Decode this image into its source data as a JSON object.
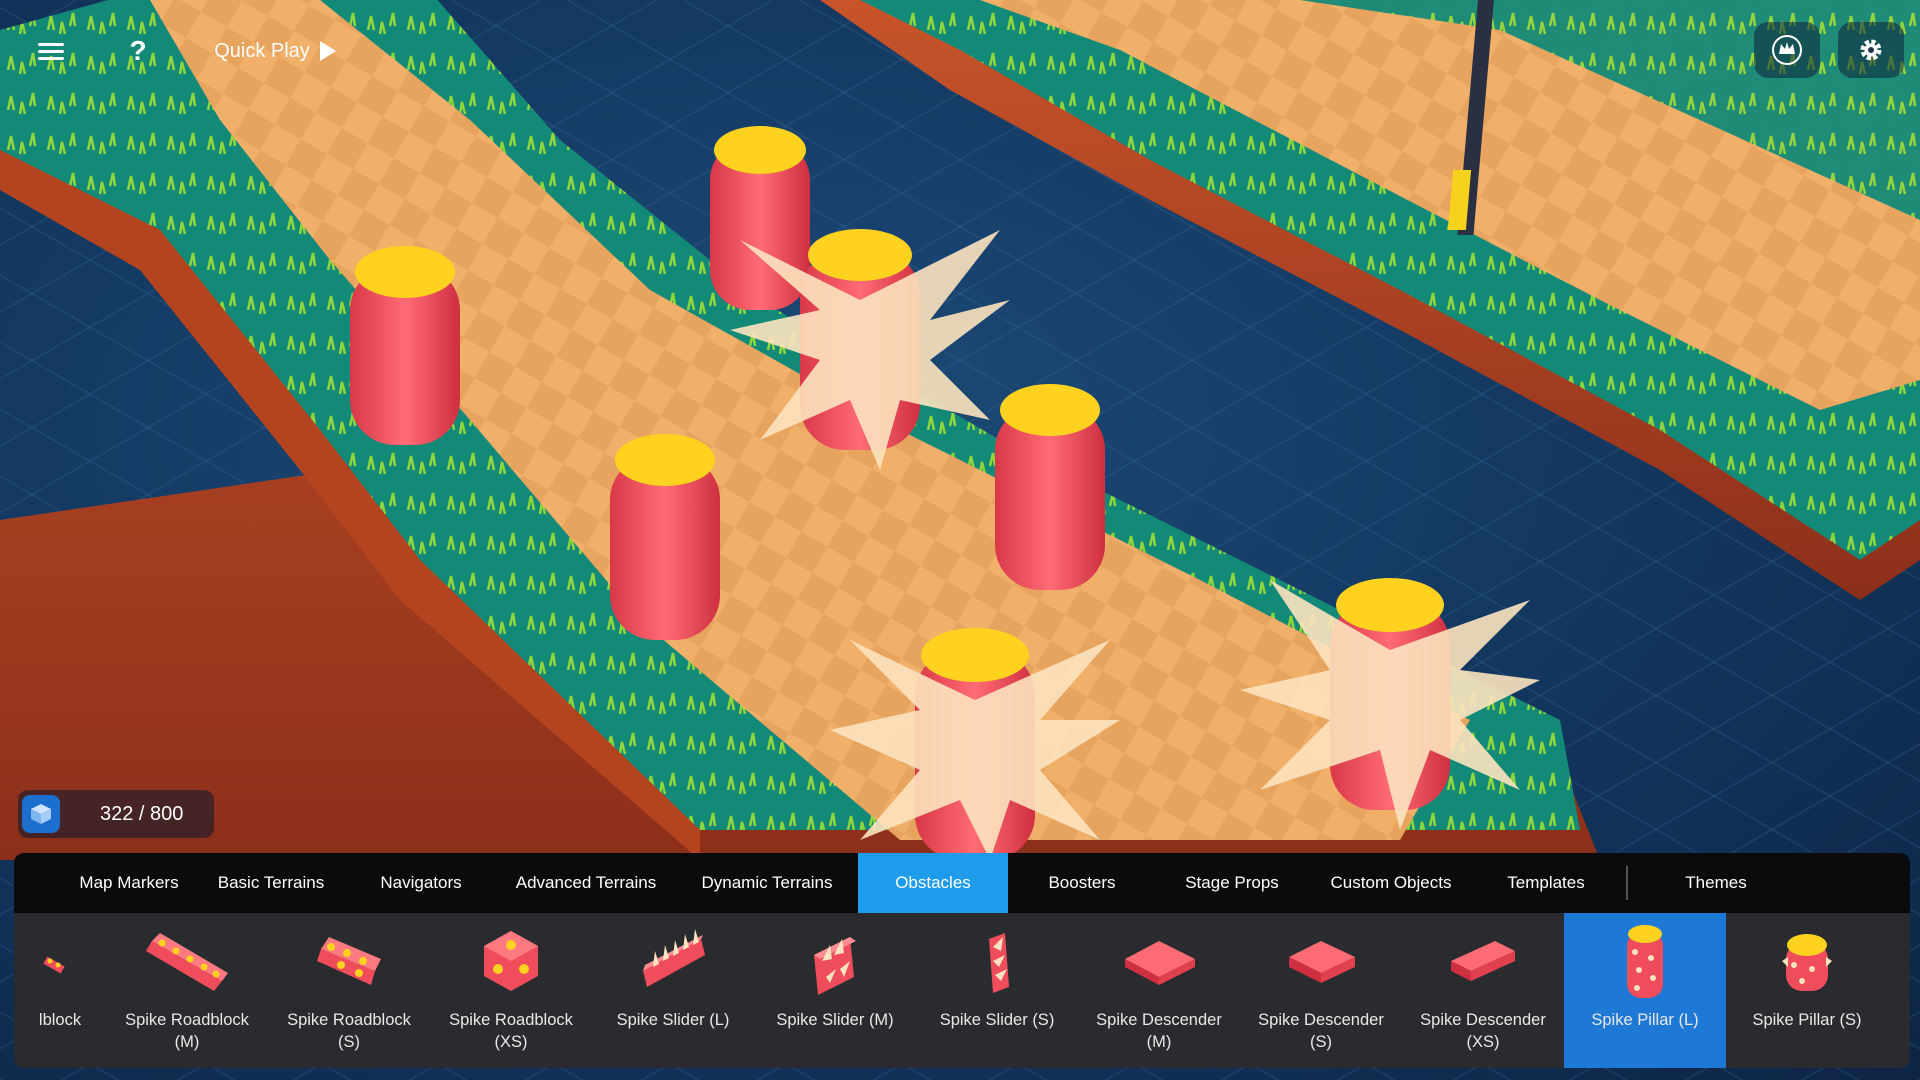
{
  "toolbar": {
    "quick_play_label": "Quick Play",
    "help_label": "?"
  },
  "counter": {
    "text": "322 / 800",
    "current": 322,
    "max": 800
  },
  "tabs": [
    {
      "label": "Map Markers"
    },
    {
      "label": "Basic Terrains"
    },
    {
      "label": "Navigators"
    },
    {
      "label": "Advanced Terrains"
    },
    {
      "label": "Dynamic Terrains"
    },
    {
      "label": "Obstacles",
      "active": true
    },
    {
      "label": "Boosters"
    },
    {
      "label": "Stage Props"
    },
    {
      "label": "Custom Objects"
    },
    {
      "label": "Templates"
    },
    {
      "label": "Themes"
    }
  ],
  "items": [
    {
      "label": "lblock",
      "icon": "spike-roadblock-icon"
    },
    {
      "label": "Spike Roadblock\n(M)",
      "icon": "spike-roadblock-m-icon"
    },
    {
      "label": "Spike Roadblock\n(S)",
      "icon": "spike-roadblock-s-icon"
    },
    {
      "label": "Spike Roadblock\n(XS)",
      "icon": "spike-roadblock-xs-icon"
    },
    {
      "label": "Spike Slider (L)",
      "icon": "spike-slider-l-icon"
    },
    {
      "label": "Spike Slider (M)",
      "icon": "spike-slider-m-icon"
    },
    {
      "label": "Spike Slider (S)",
      "icon": "spike-slider-s-icon"
    },
    {
      "label": "Spike Descender\n(M)",
      "icon": "spike-descender-m-icon"
    },
    {
      "label": "Spike Descender\n(S)",
      "icon": "spike-descender-s-icon"
    },
    {
      "label": "Spike Descender\n(XS)",
      "icon": "spike-descender-xs-icon"
    },
    {
      "label": "Spike Pillar (L)",
      "icon": "spike-pillar-l-icon",
      "selected": true
    },
    {
      "label": "Spike Pillar (S)",
      "icon": "spike-pillar-s-icon"
    }
  ],
  "colors": {
    "accent": "#1e9bea",
    "selected_item": "#1e79d6",
    "panel_bg": "#2a2b2e",
    "tabs_bg": "#0b0b0d",
    "pillar_red": "#ef4d5c",
    "pillar_top": "#ffd21f",
    "path_tile": "#f2b56e",
    "grass": "#14907f"
  }
}
